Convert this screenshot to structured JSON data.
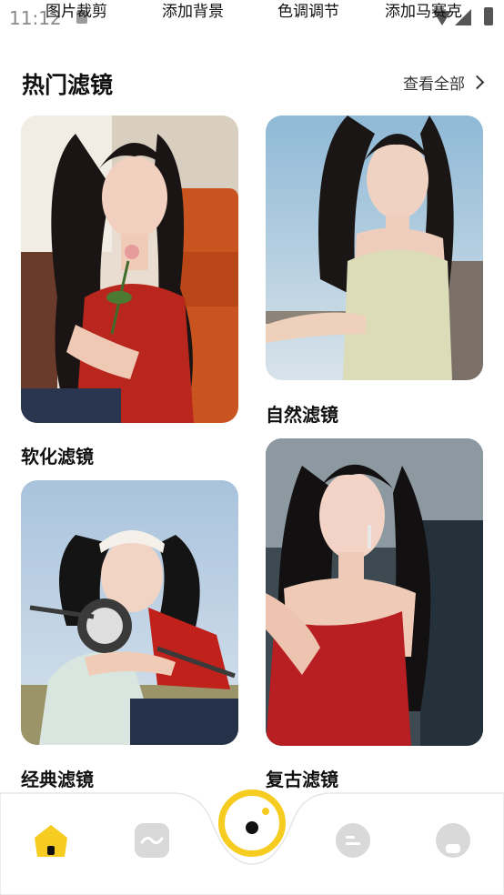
{
  "status_bar": {
    "time": "11:12"
  },
  "top_tools": [
    "图片裁剪",
    "添加背景",
    "色调调节",
    "添加马赛克"
  ],
  "section": {
    "title": "热门滤镜",
    "see_all": "查看全部"
  },
  "filters": [
    {
      "label": "软化滤镜",
      "photo": "woman-curly-hair-red-dress-holding-rose"
    },
    {
      "label": "自然滤镜",
      "photo": "woman-long-hair-beige-top-by-railing"
    },
    {
      "label": "经典滤镜",
      "photo": "woman-headband-on-mint-scooter"
    },
    {
      "label": "复古滤镜",
      "photo": "woman-red-dress-earrings-dark-background"
    }
  ],
  "bottom_nav": {
    "items": [
      "home-icon",
      "wave-icon",
      "camera-center-icon",
      "chat-icon",
      "profile-icon"
    ],
    "accent_color": "#f5cc1f",
    "inactive_color": "#d9d9d9"
  }
}
